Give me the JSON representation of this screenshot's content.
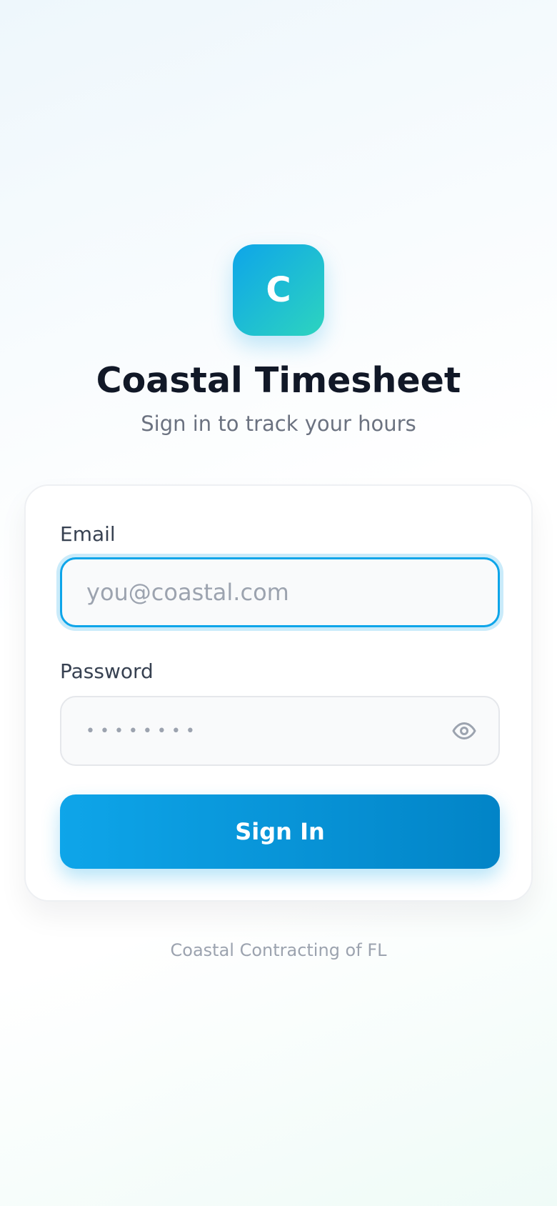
{
  "app": {
    "logo_letter": "C",
    "title": "Coastal Timesheet",
    "subtitle": "Sign in to track your hours"
  },
  "form": {
    "email": {
      "label": "Email",
      "placeholder": "you@coastal.com",
      "value": ""
    },
    "password": {
      "label": "Password",
      "masked_value": "••••••••",
      "toggle_icon": "eye-icon"
    },
    "submit_label": "Sign In"
  },
  "footer": {
    "text": "Coastal Contracting of FL"
  },
  "colors": {
    "accent": "#0ea5e9",
    "accent_dark": "#0284c7",
    "logo_gradient_end": "#2dd4bf",
    "title": "#111827",
    "muted": "#6b7280"
  }
}
